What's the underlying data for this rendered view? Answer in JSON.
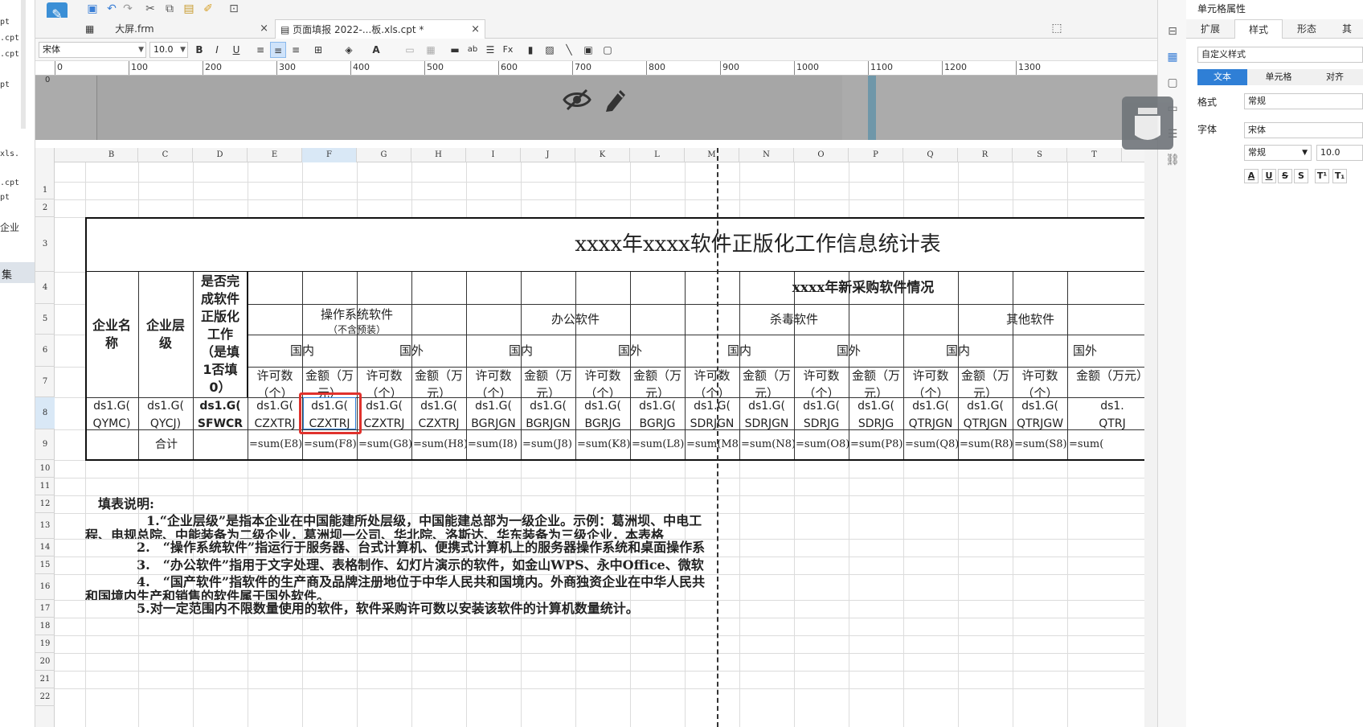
{
  "left_panel": {
    "items": [
      "pt",
      ".cpt",
      ".cpt",
      "pt",
      "xls.",
      ".cpt",
      "pt",
      "企业",
      "集"
    ]
  },
  "tabs": [
    {
      "label": "大屏.frm",
      "icon": "form-icon",
      "close": "×"
    },
    {
      "label": "页面填报 2022-...板.xls.cpt *",
      "icon": "template-icon",
      "close": "×"
    }
  ],
  "toolbar2": {
    "font": "宋体",
    "size": "10.0"
  },
  "ruler": {
    "ticks": [
      "0",
      "100",
      "200",
      "300",
      "400",
      "500",
      "600",
      "700",
      "800",
      "900",
      "1000",
      "1100",
      "1200",
      "1300"
    ],
    "vertical": "0"
  },
  "columns": [
    "B",
    "C",
    "D",
    "E",
    "F",
    "G",
    "H",
    "I",
    "J",
    "K",
    "L",
    "M",
    "N",
    "O",
    "P",
    "Q",
    "R",
    "S",
    "T"
  ],
  "rows": [
    "1",
    "2",
    "3",
    "4",
    "5",
    "6",
    "7",
    "8",
    "9",
    "10",
    "11",
    "12",
    "13",
    "14",
    "15",
    "16",
    "17",
    "18",
    "19",
    "20",
    "21",
    "22"
  ],
  "sheet": {
    "title": "xxxx年xxxx软件正版化工作信息统计表",
    "group_new": "xxxx年新采购软件情况",
    "h_company": "企业名称",
    "h_level": "企业层级",
    "h_done": "是否完成软件正版化工作（是填1否填0）",
    "h_os": "操作系统软件",
    "h_os_sub": "（不含预装）",
    "h_office": "办公软件",
    "h_av": "杀毒软件",
    "h_other": "其他软件",
    "domestic": "国内",
    "foreign": "国外",
    "lic_count": "许可数（个）",
    "amount": "金额（万元）",
    "row8": [
      "ds1.G(\nQYMC)",
      "ds1.G(\nQYCJ)",
      "ds1.G(\nSFWCR",
      "ds1.G(\nCZXTRJ",
      "ds1.G(\nCZXTRJ",
      "ds1.G(\nCZXTRJ",
      "ds1.G(\nCZXTRJ",
      "ds1.G(\nBGRJGN",
      "ds1.G(\nBGRJGN",
      "ds1.G(\nBGRJG",
      "ds1.G(\nBGRJG",
      "ds1.G(\nSDRJGN",
      "ds1.G(\nSDRJGN",
      "ds1.G(\nSDRJG",
      "ds1.G(\nSDRJG",
      "ds1.G(\nQTRJGN",
      "ds1.G(\nQTRJGN",
      "ds1.G(\nQTRJGW",
      "ds1.\nQTRJ"
    ],
    "total_label": "合计",
    "row9": [
      "=sum(E8)",
      "=sum(F8)",
      "=sum(G8)",
      "=sum(H8)",
      "=sum(I8)",
      "=sum(J8)",
      "=sum(K8)",
      "=sum(L8)",
      "=sum(M8)",
      "=sum(N8)",
      "=sum(O8)",
      "=sum(P8)",
      "=sum(Q8)",
      "=sum(R8)",
      "=sum(S8)",
      "=sum("
    ],
    "notes_title": "填表说明:",
    "note1a": "1.“企业层级”是指本企业在中国能建所处层级，中国能建总部为一级企业。示例：葛洲坝、中电工",
    "note1b": "程、电规总院、中能装备为二级企业，葛洲坝一公司、华北院、洛斯达、华东装备为三级企业，本表格",
    "note2": "2.　“操作系统软件”指运行于服务器、台式计算机、便携式计算机上的服务器操作系统和桌面操作系",
    "note3": "3.　“办公软件”指用于文字处理、表格制作、幻灯片演示的软件，如金山WPS、永中Office、微软",
    "note4a": "4.　“国产软件”指软件的生产商及品牌注册地位于中华人民共和国境内。外商独资企业在中华人民共",
    "note4b": "和国境内生产和销售的软件属于国外软件。",
    "note5": "5.对一定范围内不限数量使用的软件，软件采购许可数以安装该软件的计算机数量统计。"
  },
  "right_panel": {
    "title": "单元格属性",
    "tabs": [
      "扩展",
      "样式",
      "形态",
      "其"
    ],
    "style_select": "自定义样式",
    "segs": [
      "文本",
      "单元格",
      "对齐"
    ],
    "format_label": "格式",
    "format_value": "常规",
    "font_label": "字体",
    "font_value": "宋体",
    "font_style": "常规",
    "font_size": "10.0",
    "fmt_btns": [
      "A",
      "U",
      "S",
      "S",
      "T¹",
      "T₁"
    ]
  }
}
